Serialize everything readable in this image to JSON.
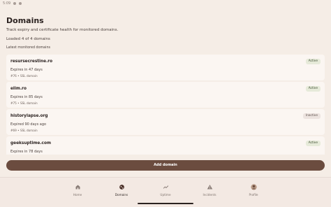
{
  "status_bar": {
    "time": "5:09"
  },
  "header": {
    "title": "Domains",
    "subtitle": "Track expiry and certificate health for monitored domains.",
    "loaded_text": "Loaded 4 of 4 domains",
    "section_label": "Latest monitored domains"
  },
  "domains": [
    {
      "name": "resursecrestine.ro",
      "expiry": "Expires in 47 days",
      "meta": "#76 • SSL domain",
      "status": "Active"
    },
    {
      "name": "elim.ro",
      "expiry": "Expires in 85 days",
      "meta": "#75 • SSL domain",
      "status": "Active"
    },
    {
      "name": "historylapse.org",
      "expiry": "Expired 90 days ago",
      "meta": "#69 • SSL domain",
      "status": "Inactive"
    },
    {
      "name": "geeksuptime.com",
      "expiry": "Expires in 78 days",
      "meta": "",
      "status": "Active"
    }
  ],
  "actions": {
    "add_domain_label": "Add domain"
  },
  "bottom_nav": {
    "items": [
      {
        "label": "Home",
        "icon": "home-icon"
      },
      {
        "label": "Domains",
        "icon": "globe-icon"
      },
      {
        "label": "Uptime",
        "icon": "trend-icon"
      },
      {
        "label": "Incidents",
        "icon": "warning-icon"
      },
      {
        "label": "Profile",
        "icon": "avatar-icon"
      }
    ],
    "active_index": 1
  },
  "colors": {
    "background": "#f5ede6",
    "primary_button": "#6b4c3f",
    "active_badge": "#e6ead9",
    "inactive_badge": "#ece3df"
  }
}
